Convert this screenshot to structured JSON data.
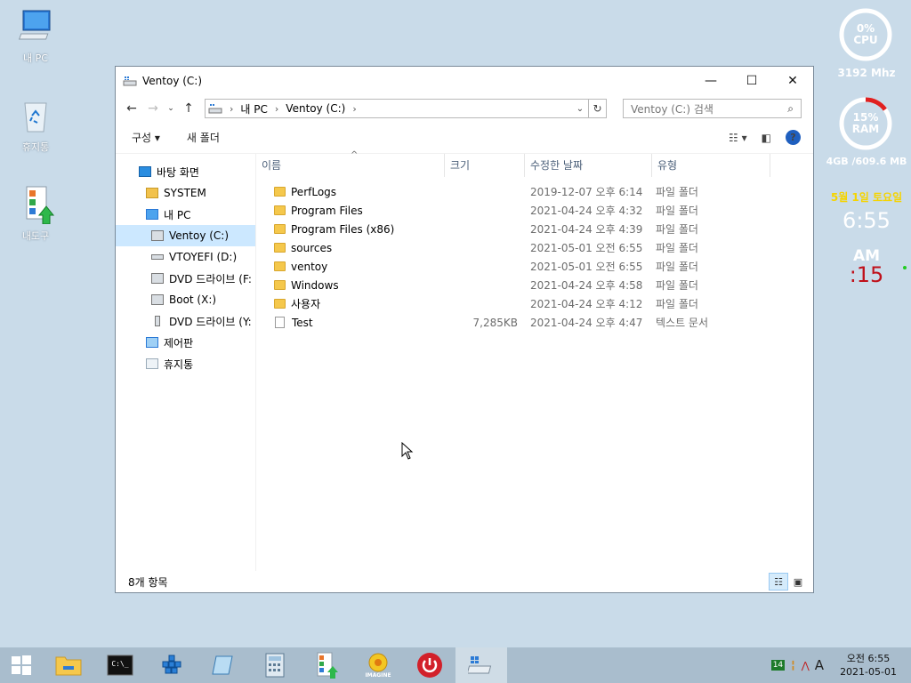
{
  "desktop": {
    "icons": [
      {
        "label": "내 PC"
      },
      {
        "label": "휴지통"
      },
      {
        "label": "내도구"
      }
    ]
  },
  "gadget": {
    "cpu_percent": "0%",
    "cpu_label": "CPU",
    "cpu_freq": "3192 Mhz",
    "ram_percent": "15%",
    "ram_label": "RAM",
    "ram_usage": "4GB /609.6 MB",
    "date": "5월 1일 토요일",
    "time": "6:55",
    "ampm": "AM",
    "seconds": ":15",
    "ram_fill": 0.15,
    "colors": {
      "ring": "#ffffff",
      "ram_arc": "#e02020",
      "date": "#f5d400",
      "seconds": "#c0101a",
      "dot": "#22cc22"
    }
  },
  "window": {
    "title": "Ventoy (C:)",
    "controls": {
      "minimize": "—",
      "maximize": "☐",
      "close": "✕"
    },
    "breadcrumb": [
      "내 PC",
      "Ventoy (C:)"
    ],
    "search_placeholder": "Ventoy (C:) 검색",
    "toolbar": {
      "organize": "구성 ▾",
      "new_folder": "새 폴더"
    },
    "nav": [
      {
        "label": "바탕 화면",
        "indent": 1,
        "icon": "desktop-icon"
      },
      {
        "label": "SYSTEM",
        "indent": 2,
        "icon": "user-folder-icon"
      },
      {
        "label": "내 PC",
        "indent": 2,
        "icon": "computer-icon"
      },
      {
        "label": "Ventoy (C:)",
        "indent": 3,
        "icon": "drive-icon",
        "selected": true
      },
      {
        "label": "VTOYEFI (D:)",
        "indent": 3,
        "icon": "drive-icon"
      },
      {
        "label": "DVD 드라이브 (F:",
        "indent": 3,
        "icon": "dvd-drive-icon"
      },
      {
        "label": "Boot (X:)",
        "indent": 3,
        "icon": "drive-icon"
      },
      {
        "label": "DVD 드라이브 (Y:",
        "indent": 3,
        "icon": "usb-drive-icon"
      },
      {
        "label": "제어판",
        "indent": 2,
        "icon": "control-panel-icon"
      },
      {
        "label": "휴지통",
        "indent": 2,
        "icon": "recycle-bin-icon"
      }
    ],
    "columns": {
      "name": "이름",
      "size": "크기",
      "date": "수정한 날짜",
      "type": "유형"
    },
    "files": [
      {
        "name": "PerfLogs",
        "size": "",
        "date": "2019-12-07 오후 6:14",
        "type": "파일 폴더",
        "kind": "folder"
      },
      {
        "name": "Program Files",
        "size": "",
        "date": "2021-04-24 오후 4:32",
        "type": "파일 폴더",
        "kind": "folder"
      },
      {
        "name": "Program Files (x86)",
        "size": "",
        "date": "2021-04-24 오후 4:39",
        "type": "파일 폴더",
        "kind": "folder"
      },
      {
        "name": "sources",
        "size": "",
        "date": "2021-05-01 오전 6:55",
        "type": "파일 폴더",
        "kind": "folder"
      },
      {
        "name": "ventoy",
        "size": "",
        "date": "2021-05-01 오전 6:55",
        "type": "파일 폴더",
        "kind": "folder"
      },
      {
        "name": "Windows",
        "size": "",
        "date": "2021-04-24 오후 4:58",
        "type": "파일 폴더",
        "kind": "folder"
      },
      {
        "name": "사용자",
        "size": "",
        "date": "2021-04-24 오후 4:12",
        "type": "파일 폴더",
        "kind": "folder"
      },
      {
        "name": "Test",
        "size": "7,285KB",
        "date": "2021-04-24 오후 4:47",
        "type": "텍스트 문서",
        "kind": "file"
      }
    ],
    "status": "8개 항목"
  },
  "taskbar": {
    "apps": [
      "start-icon",
      "file-explorer-icon",
      "command-prompt-icon",
      "blocks-app-icon",
      "notepad-icon",
      "calculator-icon",
      "my-tools-icon",
      "imagine-icon",
      "power-icon",
      "drive-window-icon"
    ],
    "imagine_label": "IMAGINE",
    "cmd_label": "C:\\_",
    "tray_badge": "14",
    "tray_ime": "A",
    "clock_time": "오전 6:55",
    "clock_date": "2021-05-01"
  }
}
